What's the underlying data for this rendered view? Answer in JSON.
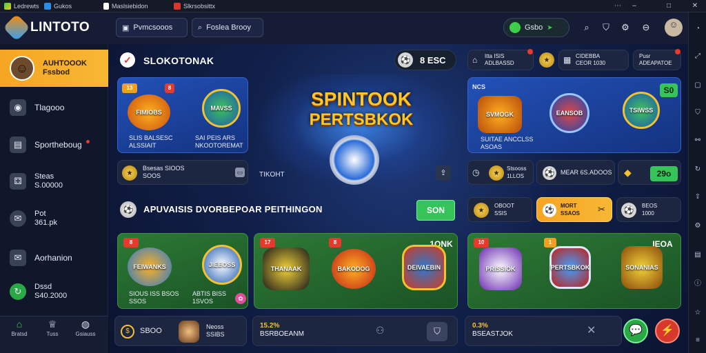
{
  "titlebar": {
    "tabs": [
      {
        "label": "Ledrewts",
        "icon": "colorful-app-icon"
      },
      {
        "label": "Gukos",
        "icon": "blue-square-icon"
      },
      {
        "label": "Maslsiebidon",
        "icon": "page-icon"
      },
      {
        "label": "Slkrsobsittx",
        "icon": "red-app-icon"
      }
    ],
    "controls": {
      "minimize": "–",
      "maximize": "□",
      "close": "✕",
      "more": "⋯"
    }
  },
  "header": {
    "brand": "LINTOTO",
    "buttons": [
      {
        "label": "Pvmcsooos"
      },
      {
        "label": "Foslea Brooy"
      }
    ],
    "wallet": "Gsbo",
    "colors": {
      "accent": "#f5a623",
      "primary_bg": "#151c33"
    }
  },
  "sidebar": {
    "active": {
      "line1": "AUHTOOOK",
      "line2": "Fssbod"
    },
    "items": [
      {
        "label": "Tlagooo",
        "icon": "gamepad-icon"
      },
      {
        "label": "Sportheboug",
        "icon": "chat-icon"
      },
      {
        "line1": "Steas",
        "line2": "S.00000",
        "icon": "dice-icon"
      },
      {
        "line1": "Pot",
        "line2": "361.pk",
        "icon": "bell-icon"
      },
      {
        "label": "Aorhanion",
        "icon": "mail-icon"
      },
      {
        "line1": "Dssd",
        "line2": "S40.2000",
        "icon": "refresh-icon"
      }
    ],
    "bottom_nav": [
      {
        "label": "Bratsd",
        "icon": "home-icon"
      },
      {
        "label": "Tuss",
        "icon": "trophy-icon"
      },
      {
        "label": "Gsiauss",
        "icon": "bag-icon"
      }
    ]
  },
  "section1": {
    "title": "SLOKOTONAK",
    "card_a": {
      "badge": "13",
      "badge2": "8",
      "emblem1": "FIMIOBS",
      "emblem2": "MAVSS",
      "line1": "SLIS BALSESC",
      "line2": "ALSSIAIT",
      "line3": "SAI PEIS ARS",
      "line4": "NKOOTOREMAT"
    },
    "bar": {
      "line1": "Bsesas SIOOS",
      "line2": "SOOS"
    },
    "hero": {
      "title_top": "SPINTOOK",
      "title_bottom": "PERTSBKOK",
      "caption": "TIKOHT",
      "balance": "8 ESC"
    },
    "right_top": {
      "line1": "Itta ISIS",
      "line2": "ADLBASSD",
      "line3": "CIDEBBA",
      "line4": "CEOR 1030",
      "line5": "Pusr",
      "line6": "ADEAPATOE"
    },
    "card_b": {
      "badge": "NCS",
      "chip": "S0",
      "emblem1": "SVMOGK",
      "emblem2": "EANSOB",
      "emblem3": "TSIWSS",
      "line1": "SUITAE ANCCLSS",
      "line2": "ASOAS"
    },
    "row_mid": {
      "item1_line1": "Stsooss",
      "item1_line2": "1LLOS",
      "item2": "MEAR 6S.ADOOS",
      "chip": "29o"
    }
  },
  "section2": {
    "title": "APUVAISIS DVORBEPOAR PEITHINGON",
    "chip": "SON",
    "right_row": {
      "a_line1": "OBOOT",
      "a_line2": "SSIS",
      "b_line1": "MORT",
      "b_line2": "SSAOS",
      "c_line1": "BEOS",
      "c_line2": "1000"
    },
    "card_c": {
      "badge": "8",
      "emblem1": "FEIWANKS",
      "emblem2": "JIEEOSS",
      "line1": "SIOUS ISS BSOS",
      "line2": "SSOS",
      "line3": "ABTIS BISS",
      "line4": "1SVOS"
    },
    "card_d": {
      "badge1": "17",
      "badge2": "8",
      "chip": "1ONK",
      "emblem1": "THANAAK",
      "emblem2": "BAKODOG",
      "emblem3": "DEIVAEBIN"
    },
    "card_e": {
      "badge1": "10",
      "badge2": "1",
      "chip": "IEOA",
      "emblem1": "PRISSIOK",
      "emblem2": "PERTSBKOK",
      "emblem3": "SONANIAS"
    }
  },
  "bottom": {
    "a": {
      "value": "SBOO",
      "line1": "Neoss",
      "line2": "SSIBS"
    },
    "b": {
      "line1": "15.2%",
      "line2": "BSRBOEANM"
    },
    "c": {
      "line1": "0.3%",
      "line2": "BSEASTJOK"
    }
  }
}
